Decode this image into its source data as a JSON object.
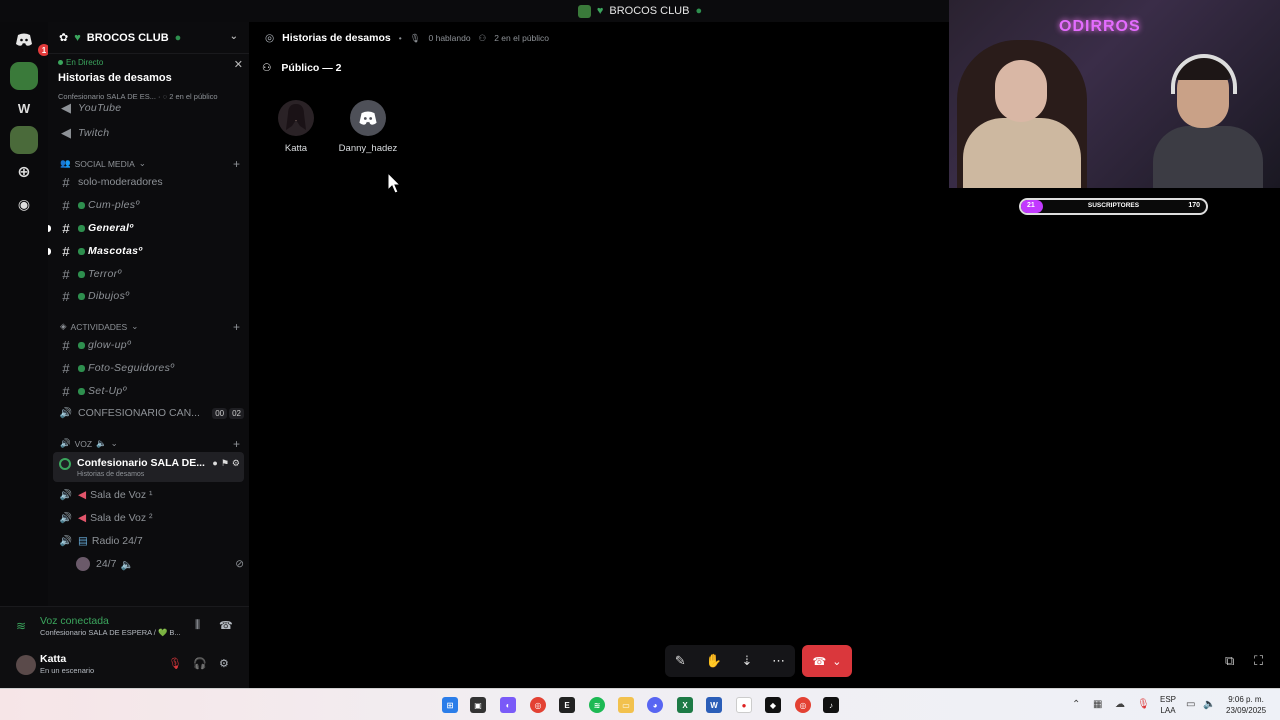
{
  "window": {
    "title": "BROCOS CLUB"
  },
  "rail": {
    "badge": "1",
    "w_label": "W"
  },
  "server": {
    "name": "BROCOS CLUB"
  },
  "live": {
    "tag": "En Directo",
    "title": "Historias de desamos",
    "sub": "Confesionario SALA DE ES...",
    "audience": "2 en el público"
  },
  "channels_top": [
    {
      "name": "YouTube"
    },
    {
      "name": "Twitch"
    }
  ],
  "cat_social": "SOCIAL MEDIA",
  "social": [
    {
      "name": "solo-moderadores"
    },
    {
      "name": "Cum-plesº"
    },
    {
      "name": "Generalº"
    },
    {
      "name": "Mascotasº"
    },
    {
      "name": "Terrorº"
    },
    {
      "name": "Dibujosº"
    }
  ],
  "cat_act": "ACTIVIDADES",
  "activities": [
    {
      "name": "glow-upº"
    },
    {
      "name": "Foto-Seguidoresº"
    },
    {
      "name": "Set-Upº"
    },
    {
      "name": "CONFESIONARIO CAN...",
      "c1": "00",
      "c2": "02"
    }
  ],
  "cat_voz": "VOZ",
  "active_channel": {
    "title": "Confesionario SALA DE...",
    "sub": "Historias de desamos"
  },
  "voice": [
    {
      "name": "Sala de Voz ¹"
    },
    {
      "name": "Sala de Voz ²"
    },
    {
      "name": "Radio 24/7"
    },
    {
      "name": "24/7"
    }
  ],
  "voice_panel": {
    "title": "Voz conectada",
    "sub": "Confesionario SALA DE ESPERA / 💚 B...",
    "user": "Katta",
    "status": "En un escenario"
  },
  "main": {
    "title": "Historias de desamos",
    "speaking": "0 hablando",
    "audience": "2 en el público",
    "section": "Público — 2",
    "members": [
      "Katta",
      "Danny_hadez"
    ]
  },
  "stream": {
    "neon": "ODIRROS",
    "sub_label": "SUSCRIPTORES",
    "sub_current": "21",
    "sub_goal": "170",
    "sub_progress": 0.12
  },
  "taskbar": {
    "lang1": "ESP",
    "lang2": "LAA",
    "time": "9:06 p. m.",
    "date": "23/09/2025"
  },
  "colors": {
    "accent_green": "#3ba55d",
    "leave_red": "#da373c",
    "sub_purple": "#c239ff"
  }
}
